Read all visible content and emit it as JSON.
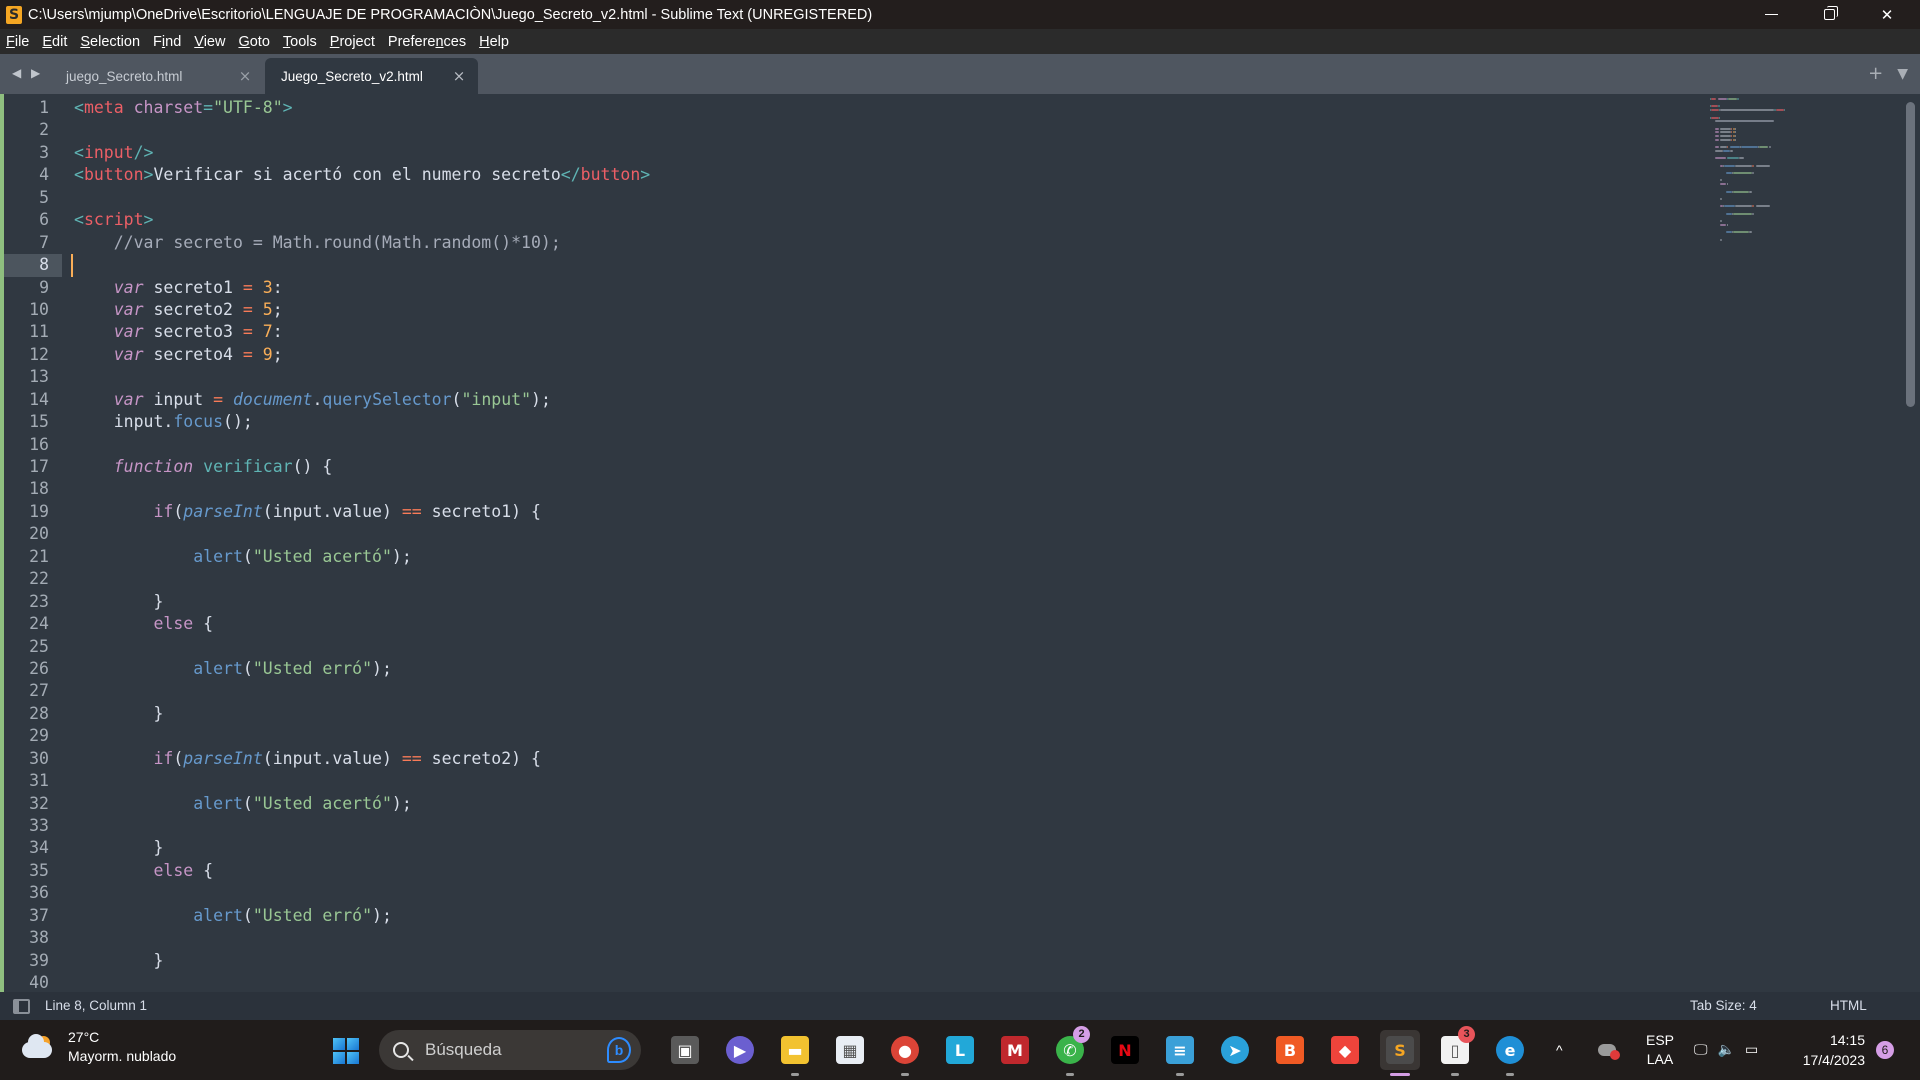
{
  "window": {
    "title": "C:\\Users\\mjump\\OneDrive\\Escritorio\\LENGUAJE DE PROGRAMACIÒN\\Juego_Secreto_v2.html - Sublime Text (UNREGISTERED)",
    "app_icon": "sublime-text-icon",
    "controls": {
      "minimize": "minimize-icon",
      "maximize": "restore-icon",
      "close": "close-icon"
    }
  },
  "menu": [
    {
      "label": "File",
      "mnemonic": "F"
    },
    {
      "label": "Edit",
      "mnemonic": "E"
    },
    {
      "label": "Selection",
      "mnemonic": "S"
    },
    {
      "label": "Find",
      "mnemonic": "i"
    },
    {
      "label": "View",
      "mnemonic": "V"
    },
    {
      "label": "Goto",
      "mnemonic": "G"
    },
    {
      "label": "Tools",
      "mnemonic": "T"
    },
    {
      "label": "Project",
      "mnemonic": "P"
    },
    {
      "label": "Preferences",
      "mnemonic": "n"
    },
    {
      "label": "Help",
      "mnemonic": "H"
    }
  ],
  "tabs": [
    {
      "label": "juego_Secreto.html",
      "active": false,
      "close": "×"
    },
    {
      "label": "Juego_Secreto_v2.html",
      "active": true,
      "close": "×"
    }
  ],
  "tabbar": {
    "nav_arrows": "◀ ▶",
    "new_tab": "+",
    "tab_menu": "▼"
  },
  "editor": {
    "current_line": 8,
    "lines": [
      [
        [
          "t-punc",
          "<"
        ],
        [
          "t-tag",
          "meta"
        ],
        [
          "",
          ""
        ],
        [
          "t-attr",
          " charset"
        ],
        [
          "t-punc",
          "="
        ],
        [
          "t-str",
          "\"UTF-8\""
        ],
        [
          "t-punc",
          ">"
        ]
      ],
      [],
      [
        [
          "t-punc",
          "<"
        ],
        [
          "t-tag",
          "input"
        ],
        [
          "t-punc",
          "/>"
        ]
      ],
      [
        [
          "t-punc",
          "<"
        ],
        [
          "t-tag",
          "button"
        ],
        [
          "t-punc",
          ">"
        ],
        [
          "",
          "Verificar si acertó con el numero secreto"
        ],
        [
          "t-punc",
          "</"
        ],
        [
          "t-tag",
          "button"
        ],
        [
          "t-punc",
          ">"
        ]
      ],
      [],
      [
        [
          "t-punc",
          "<"
        ],
        [
          "t-tag",
          "script"
        ],
        [
          "t-punc",
          ">"
        ]
      ],
      [
        [
          "",
          "    "
        ],
        [
          "t-cmt",
          "//var secreto = Math.round(Math.random()*10);"
        ]
      ],
      [],
      [
        [
          "",
          "    "
        ],
        [
          "t-kw",
          "var"
        ],
        [
          "",
          " secreto1 "
        ],
        [
          "t-op",
          "="
        ],
        [
          "",
          " "
        ],
        [
          "t-num",
          "3"
        ],
        [
          "",
          ":"
        ]
      ],
      [
        [
          "",
          "    "
        ],
        [
          "t-kw",
          "var"
        ],
        [
          "",
          " secreto2 "
        ],
        [
          "t-op",
          "="
        ],
        [
          "",
          " "
        ],
        [
          "t-num",
          "5"
        ],
        [
          "",
          ";"
        ]
      ],
      [
        [
          "",
          "    "
        ],
        [
          "t-kw",
          "var"
        ],
        [
          "",
          " secreto3 "
        ],
        [
          "t-op",
          "="
        ],
        [
          "",
          " "
        ],
        [
          "t-num",
          "7"
        ],
        [
          "",
          ":"
        ]
      ],
      [
        [
          "",
          "    "
        ],
        [
          "t-kw",
          "var"
        ],
        [
          "",
          " secreto4 "
        ],
        [
          "t-op",
          "="
        ],
        [
          "",
          " "
        ],
        [
          "t-num",
          "9"
        ],
        [
          "",
          ";"
        ]
      ],
      [],
      [
        [
          "",
          "    "
        ],
        [
          "t-kw",
          "var"
        ],
        [
          "",
          " input "
        ],
        [
          "t-op",
          "="
        ],
        [
          "",
          " "
        ],
        [
          "t-fn-it",
          "document"
        ],
        [
          "",
          "."
        ],
        [
          "t-fn",
          "querySelector"
        ],
        [
          "",
          "("
        ],
        [
          "t-str",
          "\"input\""
        ],
        [
          "",
          ");"
        ]
      ],
      [
        [
          "",
          "    input."
        ],
        [
          "t-fn",
          "focus"
        ],
        [
          "",
          "();"
        ]
      ],
      [],
      [
        [
          "",
          "    "
        ],
        [
          "t-kw",
          "function"
        ],
        [
          "",
          " "
        ],
        [
          "t-def",
          "verificar"
        ],
        [
          "",
          "() {"
        ]
      ],
      [],
      [
        [
          "",
          "        "
        ],
        [
          "t-ctl",
          "if"
        ],
        [
          "",
          "("
        ],
        [
          "t-fn-it",
          "parseInt"
        ],
        [
          "",
          "(input.value) "
        ],
        [
          "t-op",
          "=="
        ],
        [
          "",
          " secreto1) {"
        ]
      ],
      [],
      [
        [
          "",
          "            "
        ],
        [
          "t-fn",
          "alert"
        ],
        [
          "",
          "("
        ],
        [
          "t-str",
          "\"Usted acertó\""
        ],
        [
          "",
          ");"
        ]
      ],
      [],
      [
        [
          "",
          "        }"
        ]
      ],
      [
        [
          "",
          "        "
        ],
        [
          "t-ctl",
          "else"
        ],
        [
          "",
          " {"
        ]
      ],
      [],
      [
        [
          "",
          "            "
        ],
        [
          "t-fn",
          "alert"
        ],
        [
          "",
          "("
        ],
        [
          "t-str",
          "\"Usted erró\""
        ],
        [
          "",
          ");"
        ]
      ],
      [],
      [
        [
          "",
          "        }"
        ]
      ],
      [],
      [
        [
          "",
          "        "
        ],
        [
          "t-ctl",
          "if"
        ],
        [
          "",
          "("
        ],
        [
          "t-fn-it",
          "parseInt"
        ],
        [
          "",
          "(input.value) "
        ],
        [
          "t-op",
          "=="
        ],
        [
          "",
          " secreto2) {"
        ]
      ],
      [],
      [
        [
          "",
          "            "
        ],
        [
          "t-fn",
          "alert"
        ],
        [
          "",
          "("
        ],
        [
          "t-str",
          "\"Usted acertó\""
        ],
        [
          "",
          ");"
        ]
      ],
      [],
      [
        [
          "",
          "        }"
        ]
      ],
      [
        [
          "",
          "        "
        ],
        [
          "t-ctl",
          "else"
        ],
        [
          "",
          " {"
        ]
      ],
      [],
      [
        [
          "",
          "            "
        ],
        [
          "t-fn",
          "alert"
        ],
        [
          "",
          "("
        ],
        [
          "t-str",
          "\"Usted erró\""
        ],
        [
          "",
          ");"
        ]
      ],
      [],
      [
        [
          "",
          "        }"
        ]
      ],
      []
    ],
    "scroll_fraction": 0.34
  },
  "statusbar": {
    "position": "Line 8, Column 1",
    "tab_size": "Tab Size: 4",
    "syntax": "HTML"
  },
  "taskbar": {
    "weather": {
      "temp": "27°C",
      "desc": "Mayorm. nublado"
    },
    "search_placeholder": "Búsqueda",
    "apps": [
      {
        "name": "task-view",
        "glyph": "▣",
        "color": "#5a5a5a",
        "running": false,
        "badge": null
      },
      {
        "name": "teams-chat",
        "glyph": "▶",
        "color": "#6b5fd0",
        "running": false,
        "badge": null
      },
      {
        "name": "file-explorer",
        "glyph": "▬",
        "color": "#f2c230",
        "running": true,
        "badge": null
      },
      {
        "name": "microsoft-store",
        "glyph": "▦",
        "color": "#e9eef5",
        "running": false,
        "badge": null
      },
      {
        "name": "chrome",
        "glyph": "●",
        "color": "#db4437",
        "running": true,
        "badge": null
      },
      {
        "name": "l-app",
        "glyph": "L",
        "color": "#22a8d8",
        "running": false,
        "badge": null
      },
      {
        "name": "mcafee",
        "glyph": "M",
        "color": "#c0282d",
        "running": false,
        "badge": null
      },
      {
        "name": "whatsapp",
        "glyph": "✆",
        "color": "#3ab34a",
        "running": true,
        "badge": "2"
      },
      {
        "name": "netflix",
        "glyph": "N",
        "color": "#000000",
        "running": false,
        "badge": null
      },
      {
        "name": "notepad",
        "glyph": "≡",
        "color": "#3aa0d8",
        "running": true,
        "badge": null
      },
      {
        "name": "telegram",
        "glyph": "➤",
        "color": "#2aa1da",
        "running": false,
        "badge": null
      },
      {
        "name": "brave",
        "glyph": "B",
        "color": "#f05a24",
        "running": false,
        "badge": null
      },
      {
        "name": "anydesk",
        "glyph": "◆",
        "color": "#ef443b",
        "running": false,
        "badge": null
      },
      {
        "name": "sublime-text",
        "glyph": "S",
        "color": "#4b4b4b",
        "running": true,
        "active": true,
        "badge": null
      },
      {
        "name": "document-app",
        "glyph": "▯",
        "color": "#f2f2f2",
        "running": true,
        "badge": "3"
      },
      {
        "name": "edge",
        "glyph": "e",
        "color": "#1f8fd6",
        "running": true,
        "badge": null
      }
    ],
    "tray": {
      "chevron": "^",
      "lang_top": "ESP",
      "lang_bottom": "LAA",
      "time": "14:15",
      "date": "17/4/2023",
      "notifications": "6"
    }
  }
}
